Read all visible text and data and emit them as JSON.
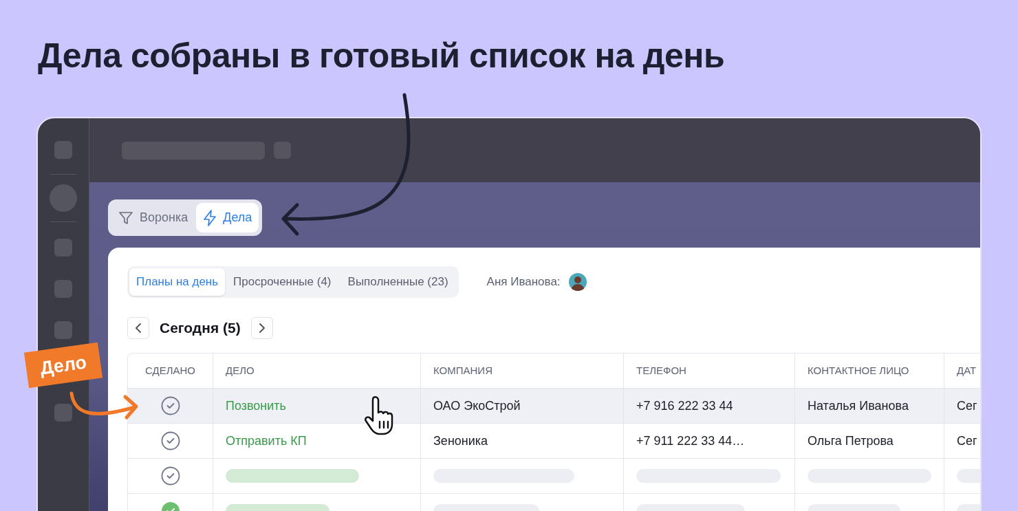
{
  "headline": "Дела собраны в готовый список на день",
  "callout": {
    "label": "Дело"
  },
  "view_switch": [
    {
      "label": "Воронка",
      "selected": false
    },
    {
      "label": "Дела",
      "selected": true
    }
  ],
  "tabs": [
    {
      "label": "Планы на день",
      "selected": true
    },
    {
      "label": "Просроченные (4)",
      "selected": false
    },
    {
      "label": "Выполненные (23)",
      "selected": false
    }
  ],
  "user": {
    "label": "Аня Иванова:"
  },
  "date_nav": {
    "label": "Сегодня (5)"
  },
  "table": {
    "columns": [
      "СДЕЛАНО",
      "ДЕЛО",
      "КОМПАНИЯ",
      "ТЕЛЕФОН",
      "КОНТАКТНОЕ ЛИЦО",
      "ДАТ"
    ],
    "rows": [
      {
        "kind": "task",
        "hovered": true,
        "done": false,
        "cells": [
          "Позвонить",
          "ОАО ЭкоСтрой",
          "+7 916 222 33 44",
          "Наталья Иванова",
          "Сег"
        ]
      },
      {
        "kind": "task",
        "hovered": false,
        "done": false,
        "cells": [
          "Отправить КП",
          "Зеноника",
          "+7 911 222 33 44…",
          "Ольга Петрова",
          "Сег"
        ]
      },
      {
        "kind": "placeholder",
        "hovered": false,
        "done": false
      },
      {
        "kind": "placeholder",
        "hovered": false,
        "done": true
      }
    ]
  }
}
